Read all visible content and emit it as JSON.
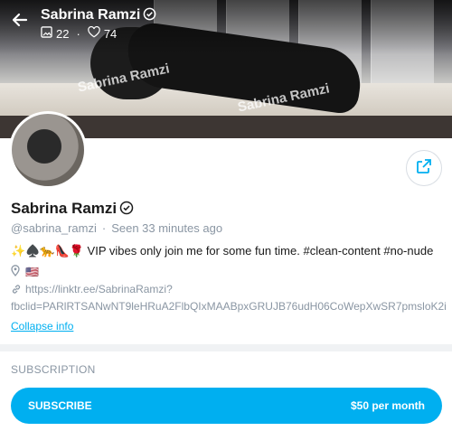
{
  "header": {
    "name": "Sabrina Ramzi",
    "photos_count": "22",
    "likes_count": "74"
  },
  "cover": {
    "watermark": "Sabrina Ramzi"
  },
  "profile": {
    "name": "Sabrina Ramzi",
    "handle": "@sabrina_ramzi",
    "seen": "Seen  33 minutes ago",
    "bio": "✨♠️🐆👠🌹 VIP vibes only join me for some fun time. #clean-content #no-nude",
    "location_flag": "🇺🇸",
    "link_line1": "https://linktr.ee/SabrinaRamzi?",
    "link_line2": "fbclid=PARlRTSANwNT9leHRuA2FlbQIxMAABpxGRUJB76udH06CoWepXwSR7pmsloK2i",
    "collapse_label": "Collapse info"
  },
  "subscription": {
    "section_title": "SUBSCRIPTION",
    "button_label": "SUBSCRIBE",
    "price": "$50 per month"
  },
  "colors": {
    "accent": "#00aff0",
    "muted": "#8a96a3"
  },
  "icons": [
    "back-arrow-icon",
    "verified-icon",
    "image-icon",
    "heart-icon",
    "share-icon",
    "location-pin-icon",
    "link-icon"
  ]
}
